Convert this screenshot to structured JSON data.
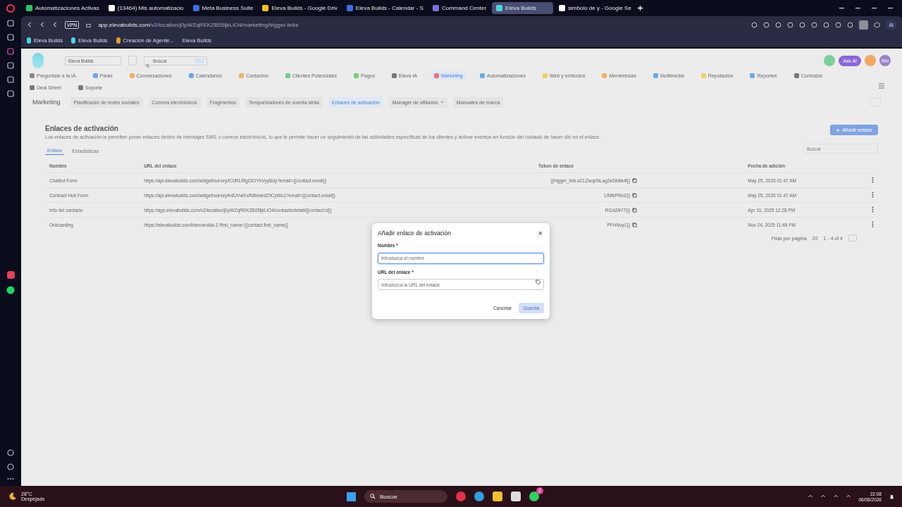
{
  "browser": {
    "tabs": [
      {
        "title": "Automatizaciones Activas",
        "selected": false
      },
      {
        "title": "(13464) Mis automatizacio",
        "selected": false
      },
      {
        "title": "Meta Business Suite",
        "selected": false
      },
      {
        "title": "Eleva Builds - Google Driv",
        "selected": false
      },
      {
        "title": "Eleva Builds - Calendar - S",
        "selected": false
      },
      {
        "title": "Command Center",
        "selected": false
      },
      {
        "title": "Eleva Builds",
        "selected": true
      },
      {
        "title": "simbolo de y - Google Se",
        "selected": false
      }
    ],
    "vpn": "VPN",
    "url_host": "app.elevabuilds.com",
    "url_path": "/v2/location/j0pWZqREKZB05ljkLiO4/marketing/trigger-links",
    "ai": "AI",
    "bookmarks": [
      "Eleva Builds",
      "Eleva Builds",
      "Creación de Agente...",
      "Eleva Builds"
    ]
  },
  "app": {
    "account": "Eleva Builds",
    "search": {
      "placeholder": "Buscar"
    },
    "ask_ai": "Ask AI",
    "avatar": "RN",
    "nav": [
      {
        "label": "Pregúntale a la IA",
        "selected": false
      },
      {
        "label": "Panel",
        "selected": false
      },
      {
        "label": "Conversaciones",
        "selected": false
      },
      {
        "label": "Calendarios",
        "selected": false
      },
      {
        "label": "Contactos",
        "selected": false
      },
      {
        "label": "Clientes Potenciales",
        "selected": false
      },
      {
        "label": "Pagos",
        "selected": false
      },
      {
        "label": "Eleva IA",
        "selected": false
      },
      {
        "label": "Marketing",
        "selected": true
      },
      {
        "label": "Automatizaciones",
        "selected": false
      },
      {
        "label": "Web y embudos",
        "selected": false
      },
      {
        "label": "Membresías",
        "selected": false
      },
      {
        "label": "Multimedia",
        "selected": false
      },
      {
        "label": "Reputación",
        "selected": false
      },
      {
        "label": "Reportes",
        "selected": false
      },
      {
        "label": "Contratos",
        "selected": false
      },
      {
        "label": "Deal Sheet",
        "selected": false
      },
      {
        "label": "Soporte",
        "selected": false
      }
    ],
    "section": "Marketing",
    "subnav": [
      {
        "label": "Planificador de redes sociales",
        "selected": false
      },
      {
        "label": "Correos electrónicos",
        "selected": false
      },
      {
        "label": "Fragmentos",
        "selected": false
      },
      {
        "label": "Temporizadores de cuenta atrás",
        "selected": false
      },
      {
        "label": "Enlaces de activación",
        "selected": true
      },
      {
        "label": "Manager de afiliados",
        "selected": false,
        "dropdown": true
      },
      {
        "label": "Manuales de marca",
        "selected": false
      }
    ],
    "page": {
      "title": "Enlaces de activación",
      "description": "Los enlaces de activación le permiten poner enlaces dentro de mensajes SMS o correos electrónicos, lo que le permite hacer un seguimiento de las actividades específicas de los clientes y activar eventos en función del cuidado de hacer clic en el enlace.",
      "add_button": "Añadir enlace",
      "tabs": [
        {
          "label": "Enlace",
          "selected": true
        },
        {
          "label": "Estadísticas",
          "selected": false
        }
      ],
      "search": {
        "placeholder": "Buscar"
      },
      "table": {
        "columns": [
          "Nombre",
          "URL del enlace",
          "Token de enlace",
          "Fecha de adición"
        ],
        "rows": [
          [
            "Chatbot Form",
            "https://api.elevabuilds.com/widget/survey/lC0RLRlgDtOYhVyyBdy?email={{contact.email}}",
            "{{trigger_link.sCLZwqcNLag2eDtdfa4l}}",
            "May 25, 2025 01:47 AM"
          ],
          [
            "Contract Hub Form",
            "https://api.elevabuilds.com/widget/survey/bdUVwXxRdbmedZ9CyWu1?email={{contact.email}}",
            "LfNtbPMu2}}",
            "May 25, 2025 01:47 AM"
          ],
          [
            "Info del contacto",
            "https://app.elevabuilds.com/v2/location/j0pWZqREKZB05ljkLiO4/contacts/detail/{{contact.id}}",
            "RGdZAY7I}}",
            "Apr 10, 2025 12:28 PM"
          ],
          [
            "Onboarding",
            "https://elevabuilds.com/bienvenida-1?first_name={{contact.first_name}}",
            "PFHNvp1}}",
            "Nov 24, 2025 11:49 PM"
          ]
        ]
      },
      "pagination": {
        "label": "Filas por página",
        "per_page": "20",
        "range": "1 - 4 of 4"
      }
    }
  },
  "dialog": {
    "title": "Añadir enlace de activación",
    "close": "×",
    "fields": [
      {
        "label": "Nombre *",
        "placeholder": "Introduzca el nombre",
        "focused": true
      },
      {
        "label": "URL del enlace *",
        "placeholder": "Introduzca la URL del enlace",
        "focused": false
      }
    ],
    "cancel": "Cancelar",
    "save": {
      "label": "Guardar",
      "disabled": true
    }
  },
  "taskbar": {
    "temp": "28°C",
    "weather": "Despejado",
    "search": "Buscar",
    "badge": "2",
    "time": "22:08",
    "date": "06/08/2026"
  }
}
